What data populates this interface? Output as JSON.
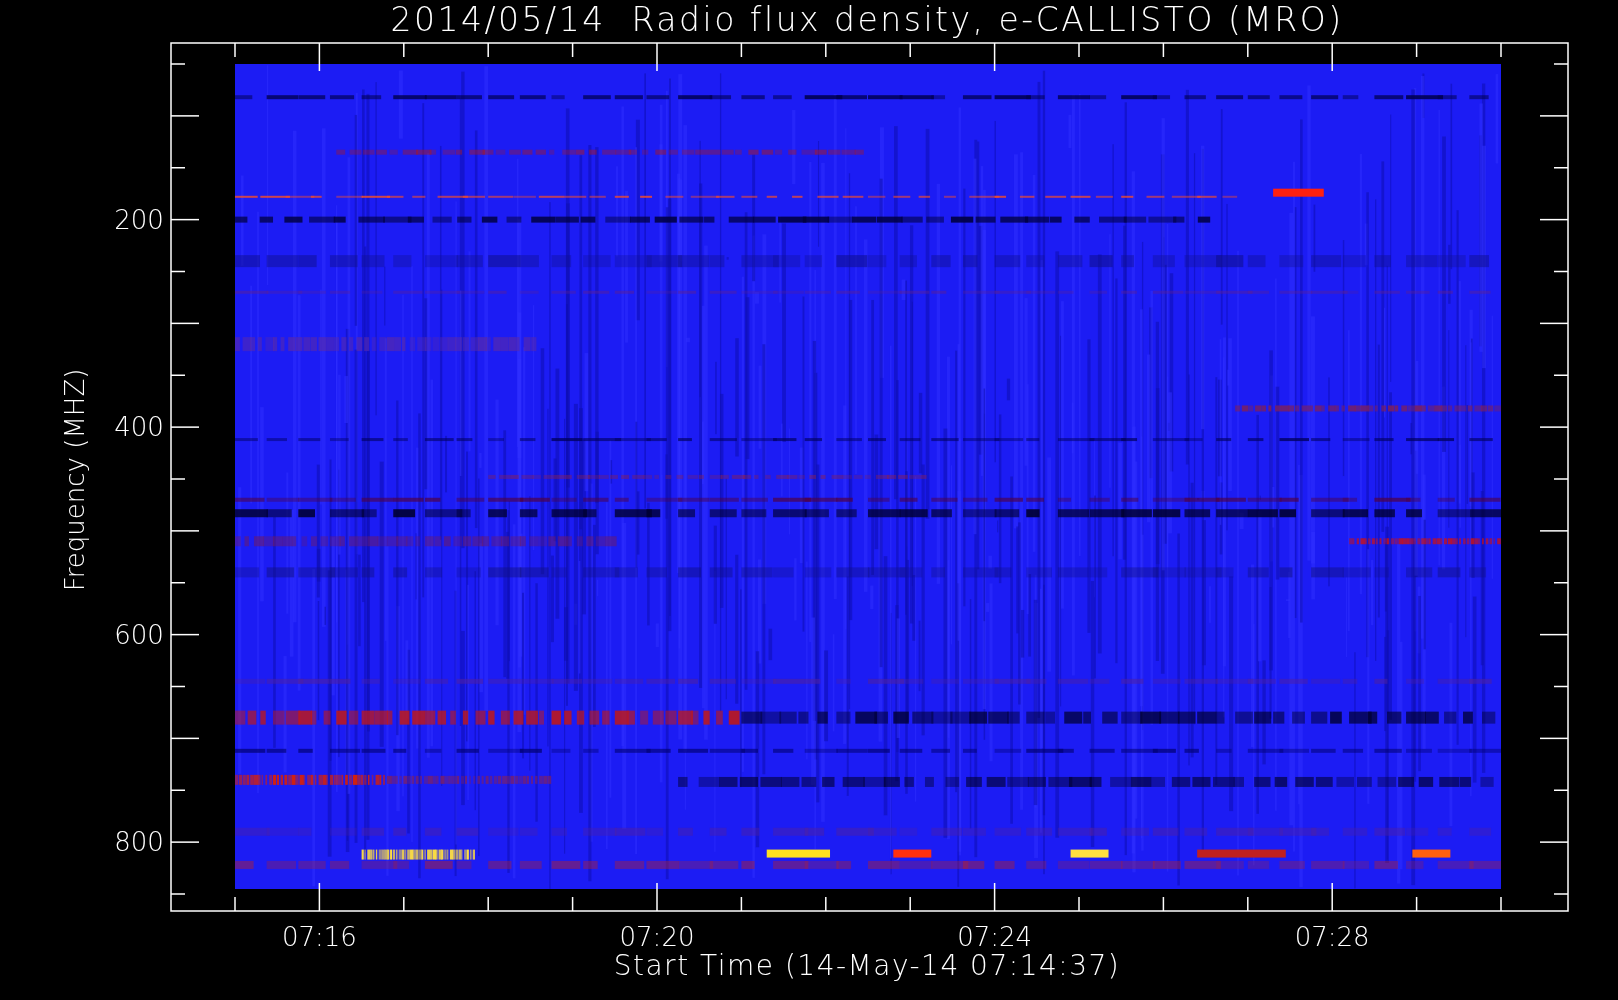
{
  "title": "2014/05/14  Radio flux density, e-CALLISTO (MRO)",
  "y_axis": {
    "label": "Frequency (MHZ)",
    "tick_labels": [
      "200",
      "400",
      "600",
      "800"
    ]
  },
  "x_axis": {
    "label": "Start Time (14-May-14 07:14:37)",
    "tick_labels": [
      "07:16",
      "07:20",
      "07:24",
      "07:28"
    ]
  }
}
